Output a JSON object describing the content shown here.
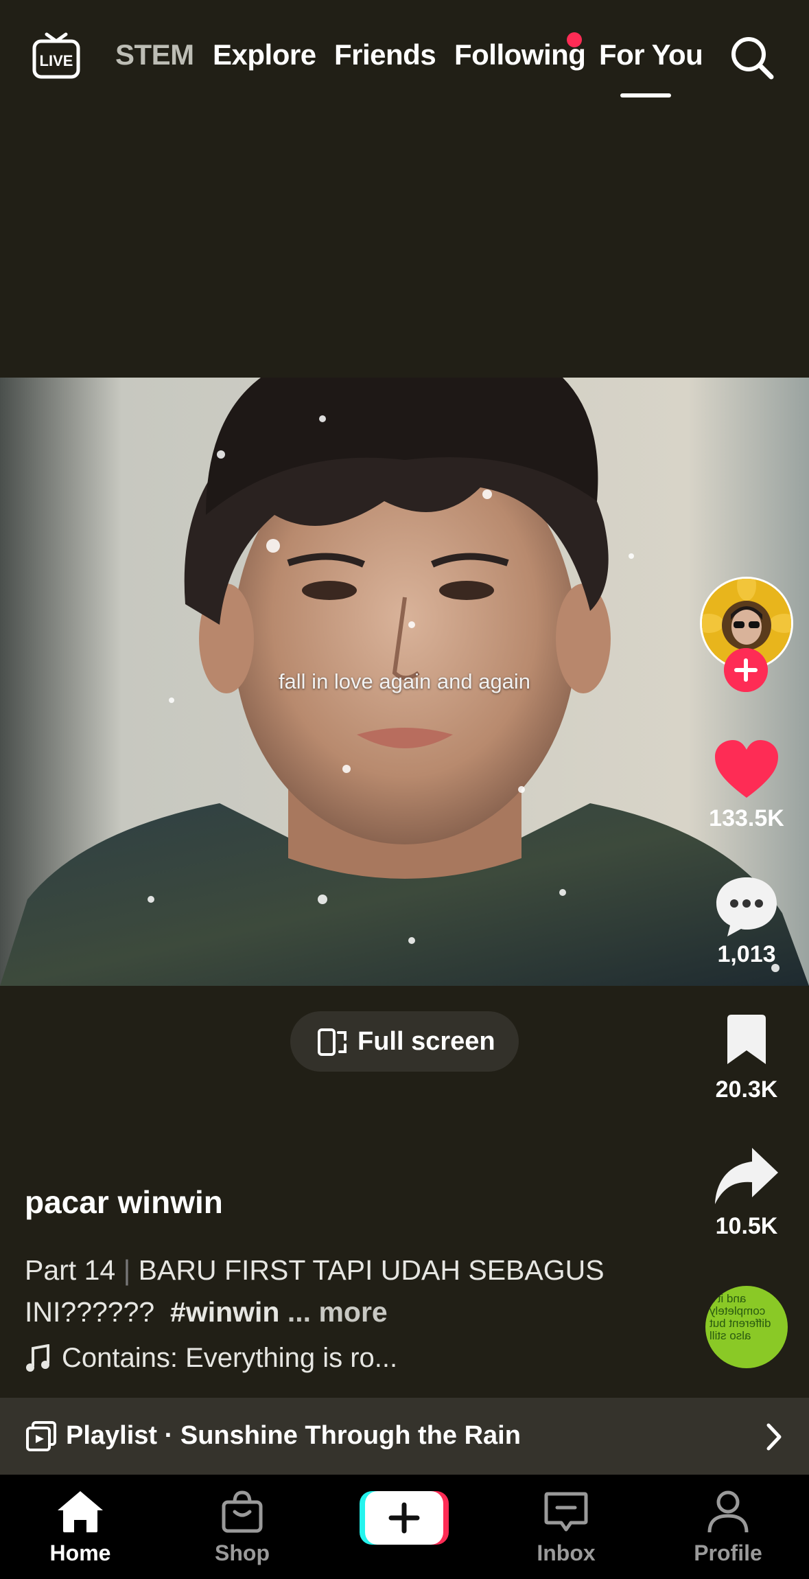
{
  "top_nav": {
    "live_label": "LIVE",
    "tabs": [
      {
        "label": "STEM",
        "active": false
      },
      {
        "label": "Explore",
        "active": false
      },
      {
        "label": "Friends",
        "active": false
      },
      {
        "label": "Following",
        "active": false,
        "has_notification_dot": true
      },
      {
        "label": "For You",
        "active": true
      }
    ]
  },
  "video": {
    "caption_overlay": "fall in love again and again"
  },
  "actions": {
    "likes": "133.5K",
    "comments": "1,013",
    "saves": "20.3K",
    "shares": "10.5K",
    "music_disc_text": "and it's completely different but also still"
  },
  "fullscreen": {
    "label": "Full screen"
  },
  "post": {
    "username": "pacar winwin",
    "part": "Part 14",
    "separator": "|",
    "title": "BARU FIRST TAPI UDAH SEBAGUS INI??????",
    "hashtag": "#winwin",
    "more": "... more",
    "sound": "Contains: Everything is ro..."
  },
  "playlist": {
    "label": "Playlist · Sunshine Through the Rain"
  },
  "bottom_nav": {
    "home": "Home",
    "shop": "Shop",
    "inbox": "Inbox",
    "profile": "Profile"
  },
  "colors": {
    "background": "#211f16",
    "accent_red": "#fe2c55",
    "create_cyan": "#25f4ee"
  },
  "icons": [
    "live-icon",
    "search-icon",
    "heart-icon",
    "comment-icon",
    "bookmark-icon",
    "share-icon",
    "fullscreen-icon",
    "music-note-icon",
    "playlist-icon",
    "chevron-right-icon",
    "home-icon",
    "shop-icon",
    "plus-icon",
    "inbox-icon",
    "profile-icon"
  ]
}
